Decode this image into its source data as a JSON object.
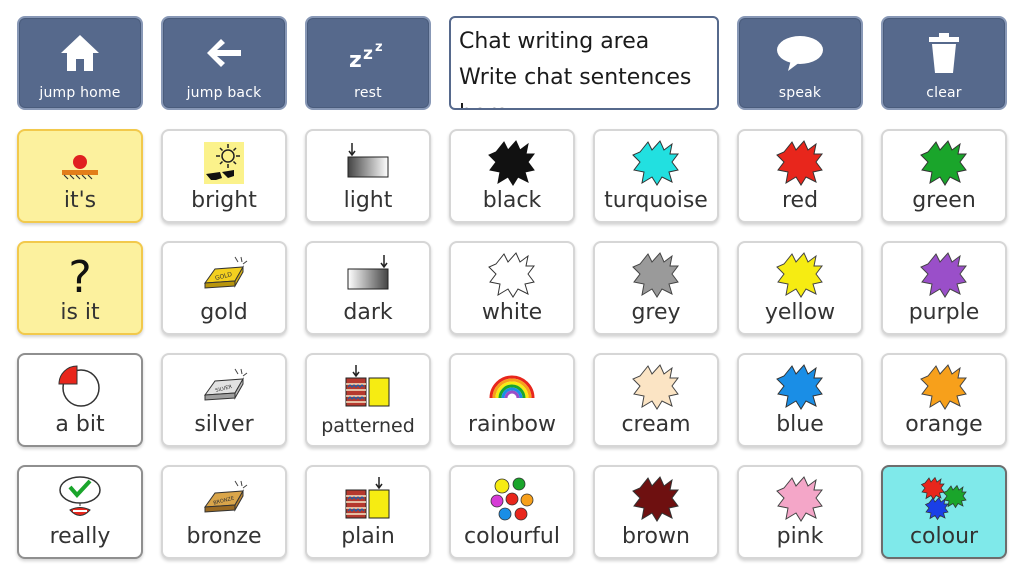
{
  "toolbar": {
    "jump_home": {
      "label": "jump home",
      "icon": "home-icon"
    },
    "jump_back": {
      "label": "jump back",
      "icon": "arrow-left-icon"
    },
    "rest": {
      "label": "rest",
      "icon": "zzz-icon"
    },
    "speak": {
      "label": "speak",
      "icon": "speech-bubble-icon"
    },
    "clear": {
      "label": "clear",
      "icon": "trash-icon"
    }
  },
  "chat": {
    "line1": "Chat writing area",
    "line2": "Write chat sentences",
    "line3": "here"
  },
  "grid": {
    "its": "it's",
    "bright": "bright",
    "light": "light",
    "black": "black",
    "turquoise": "turquoise",
    "red": "red",
    "green": "green",
    "is_it": "is it",
    "gold": "gold",
    "dark": "dark",
    "white": "white",
    "grey": "grey",
    "yellow": "yellow",
    "purple": "purple",
    "a_bit": "a bit",
    "silver": "silver",
    "patterned": "patterned",
    "rainbow": "rainbow",
    "cream": "cream",
    "blue": "blue",
    "orange": "orange",
    "really": "really",
    "bronze": "bronze",
    "plain": "plain",
    "colourful": "colourful",
    "brown": "brown",
    "pink": "pink",
    "colour": "colour"
  },
  "symbol_text": {
    "gold_bar": "GOLD",
    "silver_bar": "SILVER",
    "bronze_bar": "BRONZE"
  },
  "colors": {
    "toolbar_bg": "#56698c",
    "black": "#111111",
    "turquoise": "#22e0e0",
    "red": "#e8261c",
    "green": "#1aa52b",
    "white": "#ffffff",
    "grey": "#9a9a9a",
    "yellow": "#f6ec12",
    "purple": "#9a4fc9",
    "cream": "#fbe4c4",
    "blue": "#1a8ee6",
    "orange": "#f7a01b",
    "brown": "#6e1010",
    "pink": "#f4a6c8"
  }
}
